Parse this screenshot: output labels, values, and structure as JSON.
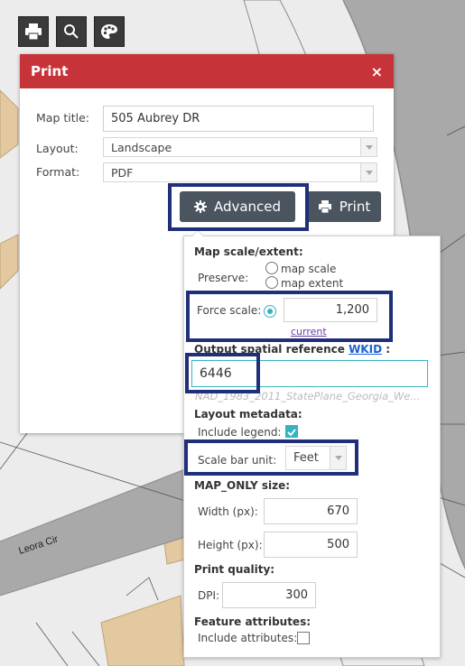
{
  "map": {
    "street_label": "Leora Cir"
  },
  "toolbar": {
    "buttons": [
      "print-icon",
      "search-icon",
      "palette-icon"
    ]
  },
  "print_panel": {
    "title": "Print",
    "close": "×",
    "map_title_label": "Map title:",
    "map_title_value": "505 Aubrey DR",
    "layout_label": "Layout:",
    "layout_value": "Landscape",
    "format_label": "Format:",
    "format_value": "PDF",
    "advanced_label": "Advanced",
    "print_label": "Print"
  },
  "advanced": {
    "scale_section": "Map scale/extent:",
    "preserve_label": "Preserve:",
    "preserve_options": [
      "map scale",
      "map extent"
    ],
    "force_scale_label": "Force scale:",
    "force_scale_value": "1,200",
    "current_link": "current",
    "spatial_ref_label": "Output spatial reference",
    "wkid_link": "WKID",
    "spatial_ref_suffix": ":",
    "wkid_value": "6446",
    "wkid_desc": "NAD_1983_2011_StatePlane_Georgia_We...",
    "metadata_section": "Layout metadata:",
    "include_legend_label": "Include legend:",
    "include_legend_checked": true,
    "scalebar_label": "Scale bar unit:",
    "scalebar_value": "Feet",
    "mapsize_section": "MAP_ONLY size:",
    "width_label": "Width (px):",
    "width_value": "670",
    "height_label": "Height (px):",
    "height_value": "500",
    "quality_section": "Print quality:",
    "dpi_label": "DPI:",
    "dpi_value": "300",
    "attributes_section": "Feature attributes:",
    "include_attr_label": "Include attributes:",
    "include_attr_checked": false
  },
  "colors": {
    "header": "#c6343a",
    "button": "#4a5560",
    "accent": "#34b3c4",
    "highlight": "#1f2f7a"
  }
}
